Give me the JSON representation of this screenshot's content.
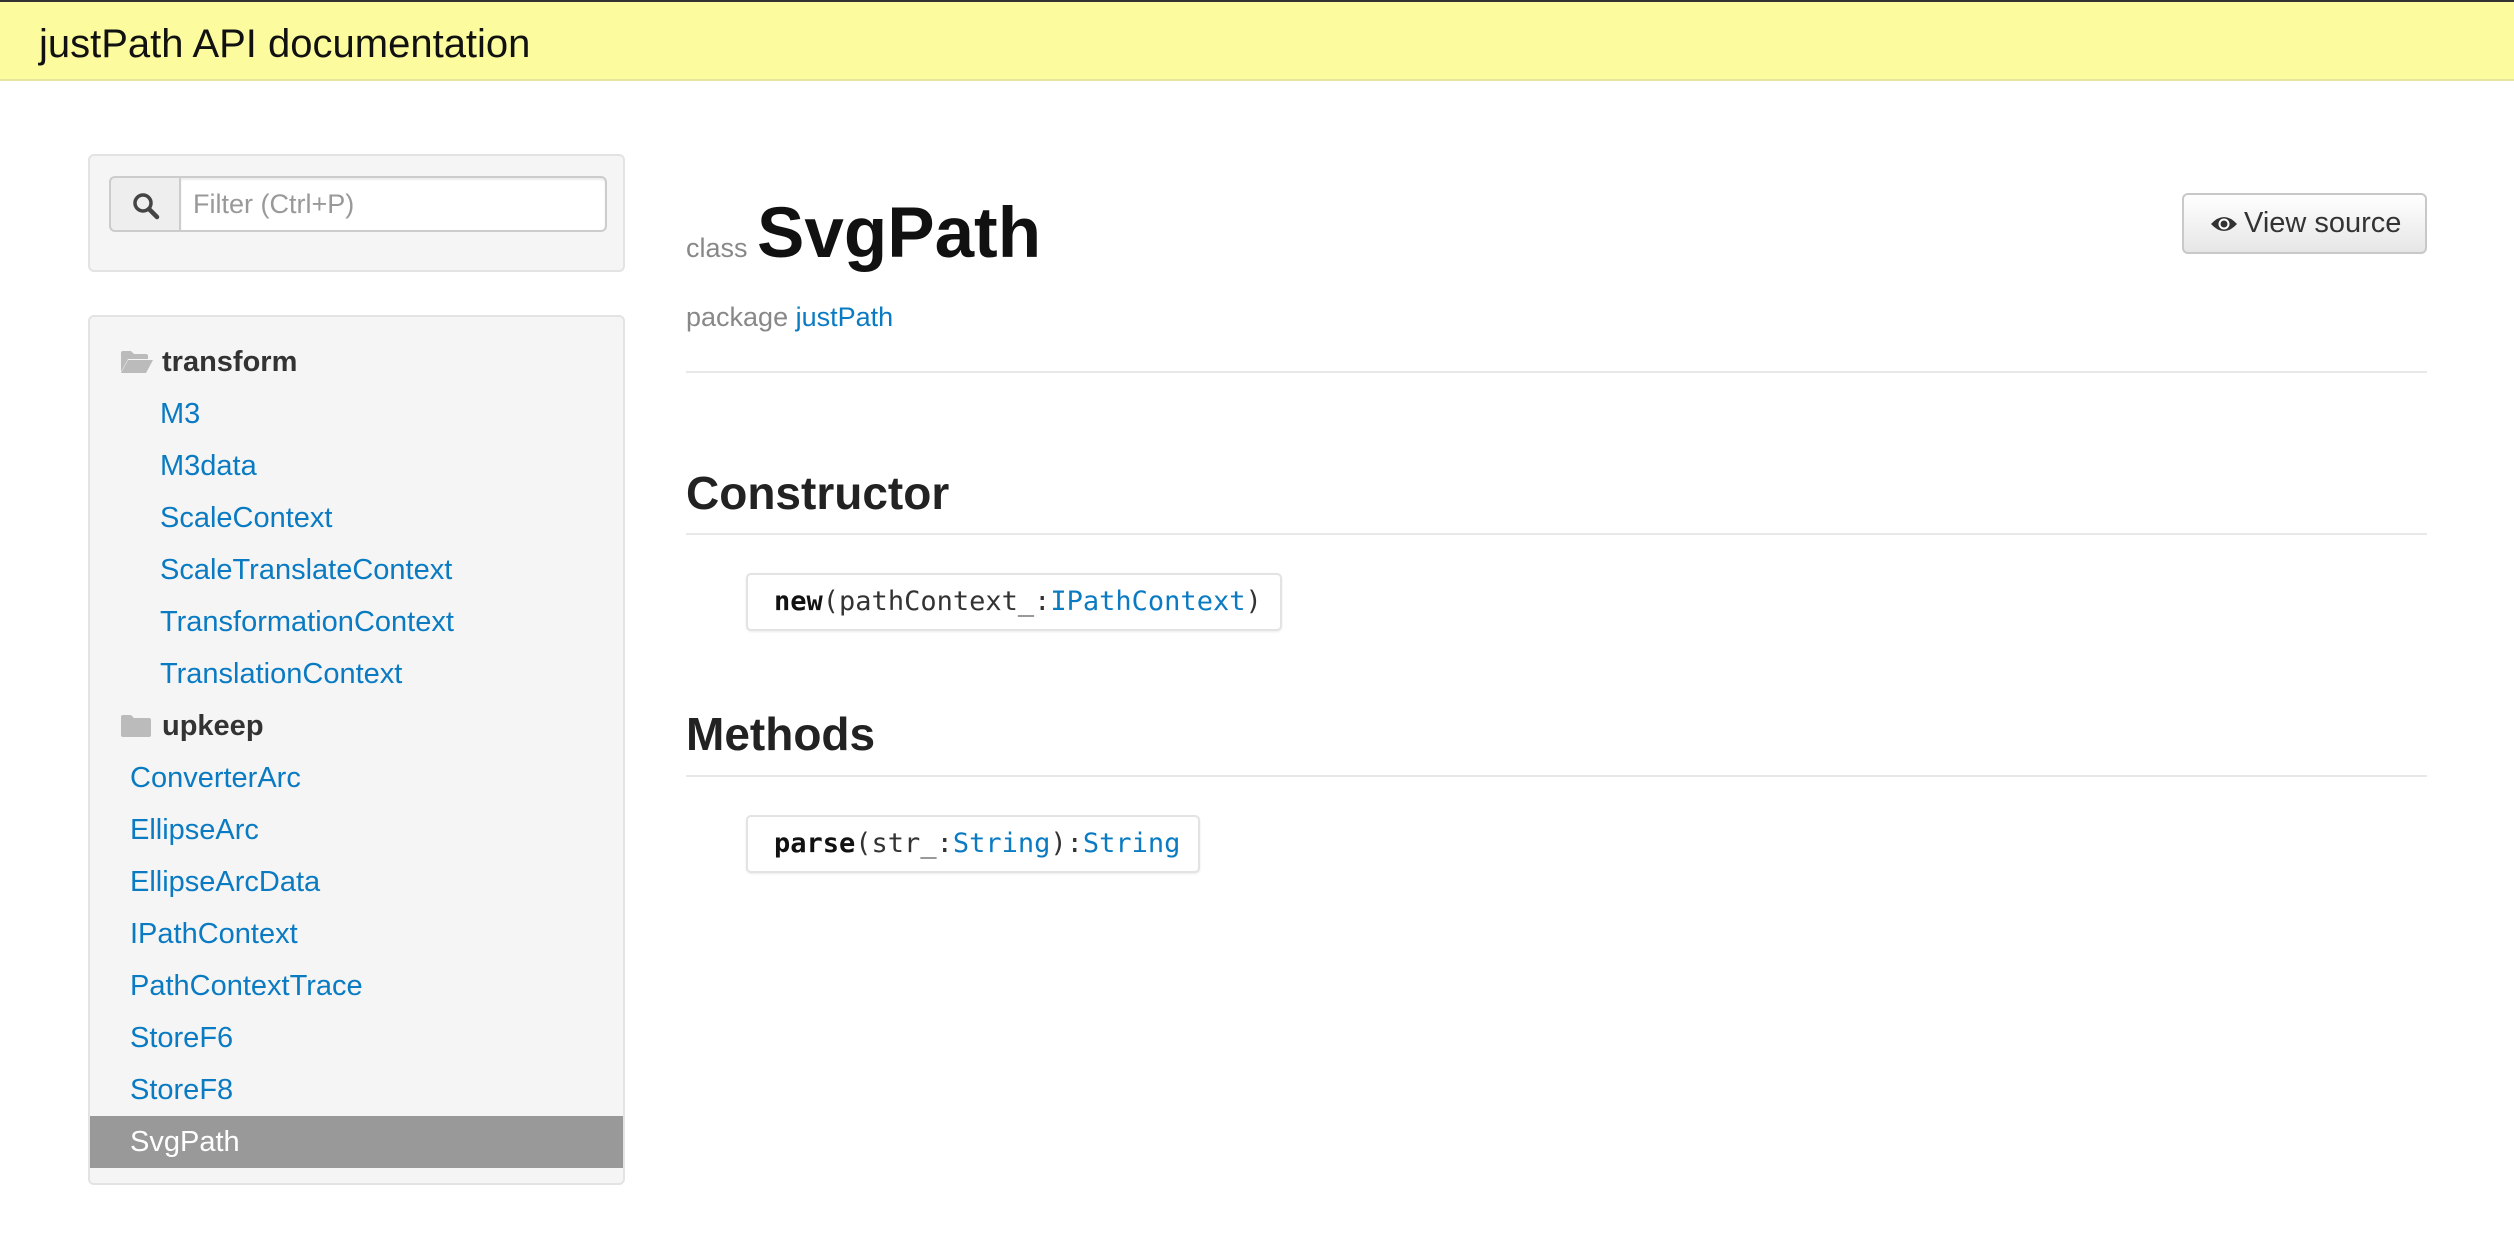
{
  "header": {
    "title": "justPath API documentation"
  },
  "filter": {
    "placeholder": "Filter (Ctrl+P)",
    "icon": "search-icon"
  },
  "nav": {
    "folders": [
      {
        "name": "transform",
        "icon": "folder-open-icon",
        "items": [
          "M3",
          "M3data",
          "ScaleContext",
          "ScaleTranslateContext",
          "TransformationContext",
          "TranslationContext"
        ]
      },
      {
        "name": "upkeep",
        "icon": "folder-closed-icon",
        "items": []
      }
    ],
    "items": [
      "ConverterArc",
      "EllipseArc",
      "EllipseArcData",
      "IPathContext",
      "PathContextTrace",
      "StoreF6",
      "StoreF8",
      "SvgPath"
    ],
    "active": "SvgPath"
  },
  "main": {
    "kind": "class",
    "name": "SvgPath",
    "package_label": "package",
    "package_name": "justPath",
    "view_source": "View source",
    "constructor_heading": "Constructor",
    "constructor": {
      "name": "new",
      "open": "(",
      "param": "pathContext_",
      "colon": ":",
      "param_type": "IPathContext",
      "close": ")"
    },
    "methods_heading": "Methods",
    "methods": [
      {
        "name": "parse",
        "open": "(",
        "param": "str_",
        "colon": ":",
        "param_type": "String",
        "close": "):",
        "return_type": "String"
      }
    ]
  },
  "colors": {
    "header_bg": "#fcfc9e",
    "link": "#0a7bc2",
    "active_bg": "#999999"
  }
}
